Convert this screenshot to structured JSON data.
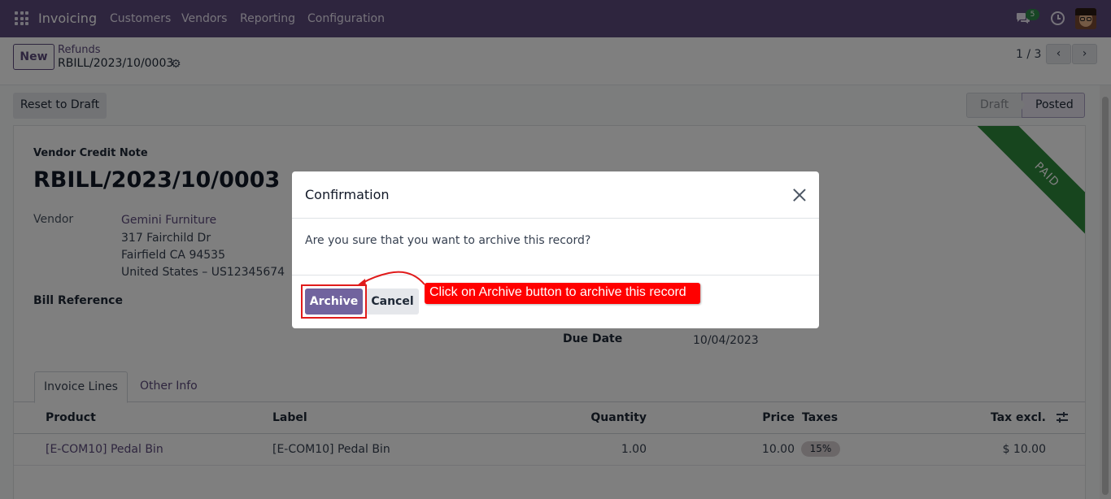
{
  "navbar": {
    "app_name": "Invoicing",
    "menu": [
      "Customers",
      "Vendors",
      "Reporting",
      "Configuration"
    ],
    "message_count": "5",
    "icons": [
      "apps-grid-icon",
      "chat-icon",
      "clock-icon",
      "avatar"
    ]
  },
  "control_panel": {
    "new_label": "New",
    "breadcrumb_parent": "Refunds",
    "breadcrumb_current": "RBILL/2023/10/0003",
    "pager": "1 / 3"
  },
  "action_bar": {
    "reset_label": "Reset to Draft",
    "statuses": [
      "Draft",
      "Posted"
    ],
    "active_status": "Posted"
  },
  "form": {
    "doc_type": "Vendor Credit Note",
    "number": "RBILL/2023/10/0003",
    "ribbon": "PAID",
    "vendor_label": "Vendor",
    "vendor_name": "Gemini Furniture",
    "vendor_address": [
      "317 Fairchild Dr",
      "Fairfield CA 94535",
      "United States – US12345674"
    ],
    "bill_reference_label": "Bill Reference",
    "due_date_label": "Due Date",
    "due_date": "10/04/2023",
    "tabs": [
      "Invoice Lines",
      "Other Info"
    ],
    "columns": [
      "Product",
      "Label",
      "Quantity",
      "Price",
      "Taxes",
      "Tax excl."
    ],
    "lines": [
      {
        "product": "[E-COM10] Pedal Bin",
        "label": "[E-COM10] Pedal Bin",
        "quantity": "1.00",
        "price": "10.00",
        "taxes": "15%",
        "tax_excl": "$ 10.00"
      }
    ]
  },
  "dialog": {
    "title": "Confirmation",
    "message": "Are you sure that you want to archive this record?",
    "archive_label": "Archive",
    "cancel_label": "Cancel"
  },
  "annotation": {
    "text": "Click on Archive button to archive this record",
    "color": "#ff0000"
  },
  "colors": {
    "brand": "#5c4a7d",
    "primary_button": "#71639e",
    "ribbon": "#2e8b3c"
  }
}
